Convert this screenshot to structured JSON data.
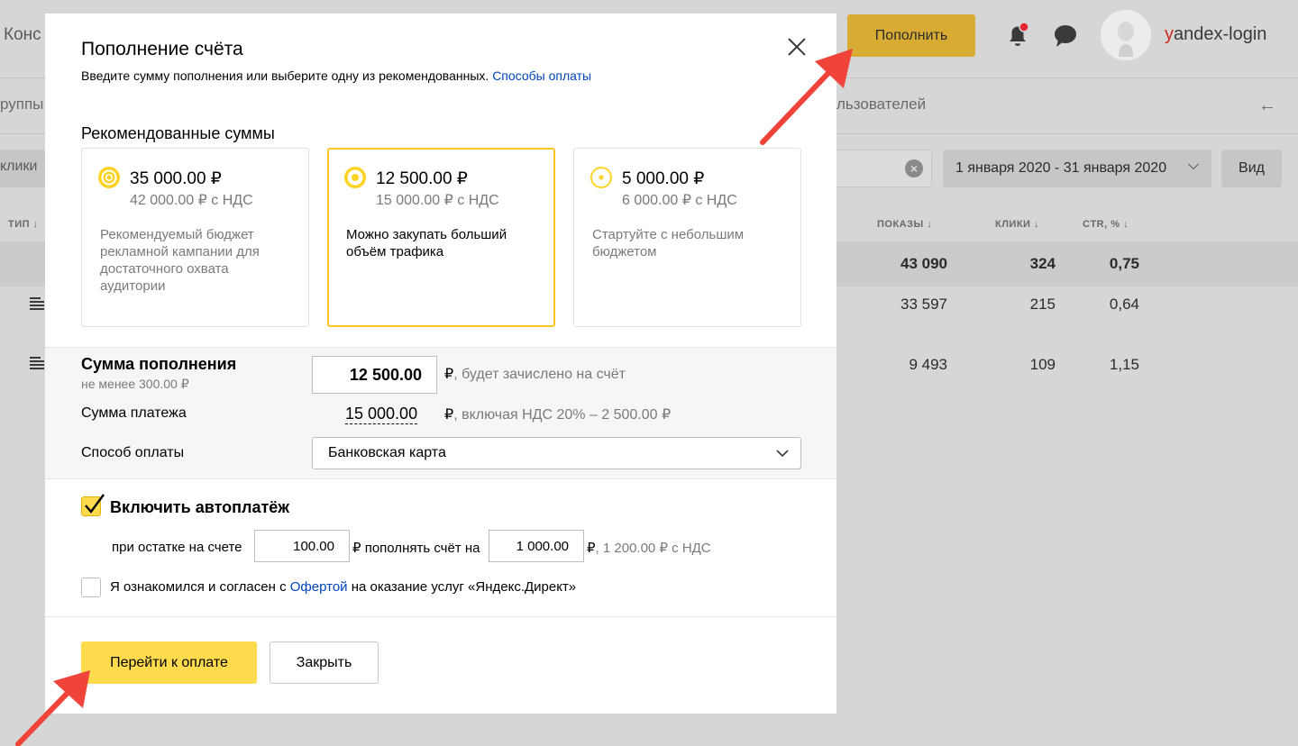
{
  "header": {
    "page_title_fragment": "Конс",
    "topup_label": "Пополнить",
    "login_first_letter": "y",
    "login_rest": "andex-login"
  },
  "tabs": {
    "left_fragment": "руппы",
    "right_fragment": "льзователей"
  },
  "filters": {
    "left_fragment": "клики",
    "date_range": "1 января 2020 - 31 января 2020",
    "view_label": "Вид"
  },
  "table": {
    "col_type": "ТИП",
    "col_impressions": "ПОКАЗЫ",
    "col_clicks": "КЛИКИ",
    "col_ctr": "CTR, %",
    "sort_arrow": "↓",
    "total": {
      "impressions": "43 090",
      "clicks": "324",
      "ctr": "0,75"
    },
    "rows": [
      {
        "impressions": "33 597",
        "clicks": "215",
        "ctr": "0,64"
      },
      {
        "impressions": "9 493",
        "clicks": "109",
        "ctr": "1,15"
      }
    ]
  },
  "modal": {
    "title": "Пополнение счёта",
    "subtitle": "Введите сумму пополнения или выберите одну из рекомендованных.",
    "payment_methods_link": "Способы оплаты",
    "recommended_title": "Рекомендованные суммы",
    "cards": [
      {
        "amount": "35 000.00 ₽",
        "vat": "42 000.00 ₽ с НДС",
        "description": "Рекомендуемый бюджет рекламной кампании для достаточного охвата аудитории"
      },
      {
        "amount": "12 500.00 ₽",
        "vat": "15 000.00 ₽ с НДС",
        "description": "Можно закупать больший объём трафика"
      },
      {
        "amount": "5 000.00 ₽",
        "vat": "6 000.00 ₽ с НДС",
        "description": "Стартуйте с небольшим бюджетом"
      }
    ],
    "sum_label": "Сумма пополнения",
    "sum_min": "не менее 300.00 ₽",
    "sum_value": "12 500.00",
    "sum_currency": "₽",
    "sum_note": ", будет зачислено на счёт",
    "payment_label": "Сумма платежа",
    "payment_amount": "15 000.00",
    "payment_note": ", включая НДС 20% – 2 500.00 ₽",
    "method_label": "Способ оплаты",
    "method_value": "Банковская карта",
    "autopay_label": "Включить автоплатёж",
    "autopay_balance_label": "при остатке на счете",
    "autopay_balance_value": "100.00",
    "autopay_topup_label": "₽ пополнять счёт на",
    "autopay_topup_value": "1 000.00",
    "autopay_vat_note": ", 1 200.00 ₽ с НДС",
    "agree_prefix": "Я ознакомился и согласен с",
    "agree_link": "Офертой",
    "agree_suffix": "на оказание услуг «Яндекс.Директ»",
    "pay_button": "Перейти к оплате",
    "close_button": "Закрыть"
  },
  "colors": {
    "accent_yellow": "#ffdb4d",
    "selected_border": "#ffc525",
    "link": "#0044bb",
    "annotation_arrow": "#f0443a"
  }
}
